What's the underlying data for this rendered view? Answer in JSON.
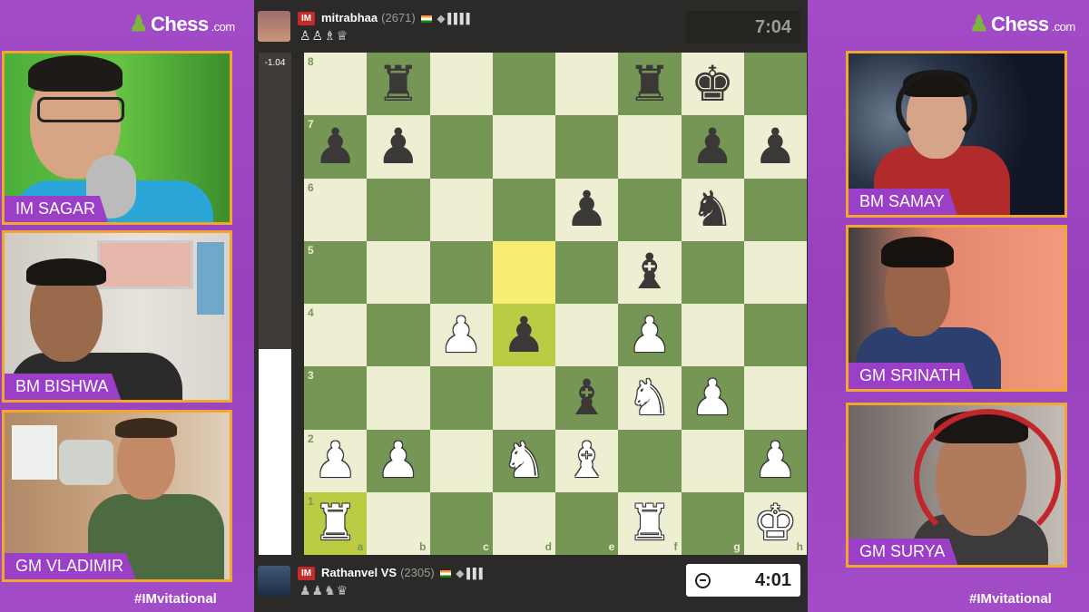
{
  "brand": {
    "logo_text": "Chess",
    "logo_suffix": ".com",
    "hashtag": "#IMvitational"
  },
  "left_cams": [
    {
      "name": "IM SAGAR"
    },
    {
      "name": "BM BISHWA"
    },
    {
      "name": "GM VLADIMIR"
    }
  ],
  "right_cams": [
    {
      "name": "BM SAMAY"
    },
    {
      "name": "GM SRINATH"
    },
    {
      "name": "GM SURYA"
    }
  ],
  "top_player": {
    "title": "IM",
    "name": "mitrabhaa",
    "rating": "(2671)",
    "captured": "♙♙♗♕",
    "clock": "7:04"
  },
  "bottom_player": {
    "title": "IM",
    "name": "Rathanvel VS",
    "rating": "(2305)",
    "captured": "♟♟♞♛",
    "clock": "4:01"
  },
  "eval": {
    "label": "-1.04",
    "white_fraction": 0.41
  },
  "board": {
    "files": [
      "a",
      "b",
      "c",
      "d",
      "e",
      "f",
      "g",
      "h"
    ],
    "ranks": [
      "8",
      "7",
      "6",
      "5",
      "4",
      "3",
      "2",
      "1"
    ],
    "highlights": [
      "d5",
      "d4",
      "a1"
    ],
    "position": [
      [
        "",
        "bR",
        "",
        "",
        "",
        "bR",
        "bK",
        ""
      ],
      [
        "bP",
        "bP",
        "",
        "",
        "",
        "",
        "bP",
        "bP"
      ],
      [
        "",
        "",
        "",
        "",
        "bP",
        "",
        "bN",
        ""
      ],
      [
        "",
        "",
        "",
        "",
        "",
        "bB",
        "",
        ""
      ],
      [
        "",
        "",
        "wP",
        "bP",
        "",
        "wP",
        "",
        ""
      ],
      [
        "",
        "",
        "",
        "",
        "bB",
        "wN",
        "wP",
        ""
      ],
      [
        "wP",
        "wP",
        "",
        "wN",
        "wB",
        "",
        "",
        "wP"
      ],
      [
        "wR",
        "",
        "",
        "",
        "",
        "wR",
        "",
        "wK"
      ]
    ]
  },
  "glyphs": {
    "K": "♚",
    "Q": "♛",
    "R": "♜",
    "B": "♝",
    "N": "♞",
    "P": "♟"
  }
}
